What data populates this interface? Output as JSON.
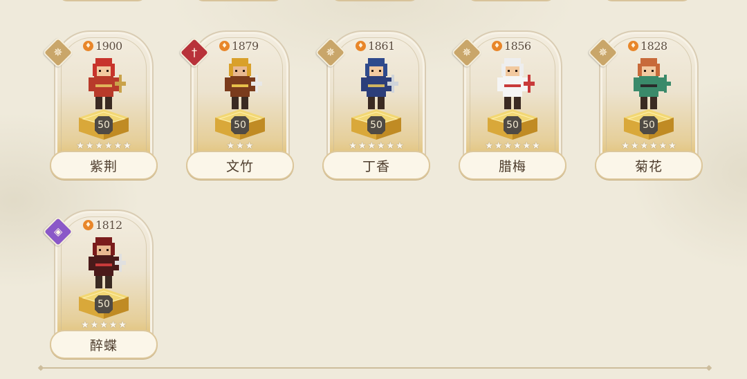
{
  "colors": {
    "badge_gold": "#c9a66a",
    "badge_red": "#b8323a",
    "badge_purple": "#8a58c8",
    "flame": "#e8862a",
    "level_badge": "#4f4a44"
  },
  "heroes": [
    {
      "name": "紫荆",
      "power": "1900",
      "level": "50",
      "stars": 6,
      "class_icon": "compass-star-icon",
      "class_color": "#c9a66a"
    },
    {
      "name": "文竹",
      "power": "1879",
      "level": "50",
      "stars": 3,
      "class_icon": "sword-icon",
      "class_color": "#b8323a"
    },
    {
      "name": "丁香",
      "power": "1861",
      "level": "50",
      "stars": 6,
      "class_icon": "compass-star-icon",
      "class_color": "#c9a66a"
    },
    {
      "name": "腊梅",
      "power": "1856",
      "level": "50",
      "stars": 6,
      "class_icon": "compass-star-icon",
      "class_color": "#c9a66a"
    },
    {
      "name": "菊花",
      "power": "1828",
      "level": "50",
      "stars": 6,
      "class_icon": "compass-star-icon",
      "class_color": "#c9a66a"
    },
    {
      "name": "醉蝶",
      "power": "1812",
      "level": "50",
      "stars": 5,
      "class_icon": "mystic-swirl-icon",
      "class_color": "#8a58c8"
    }
  ]
}
